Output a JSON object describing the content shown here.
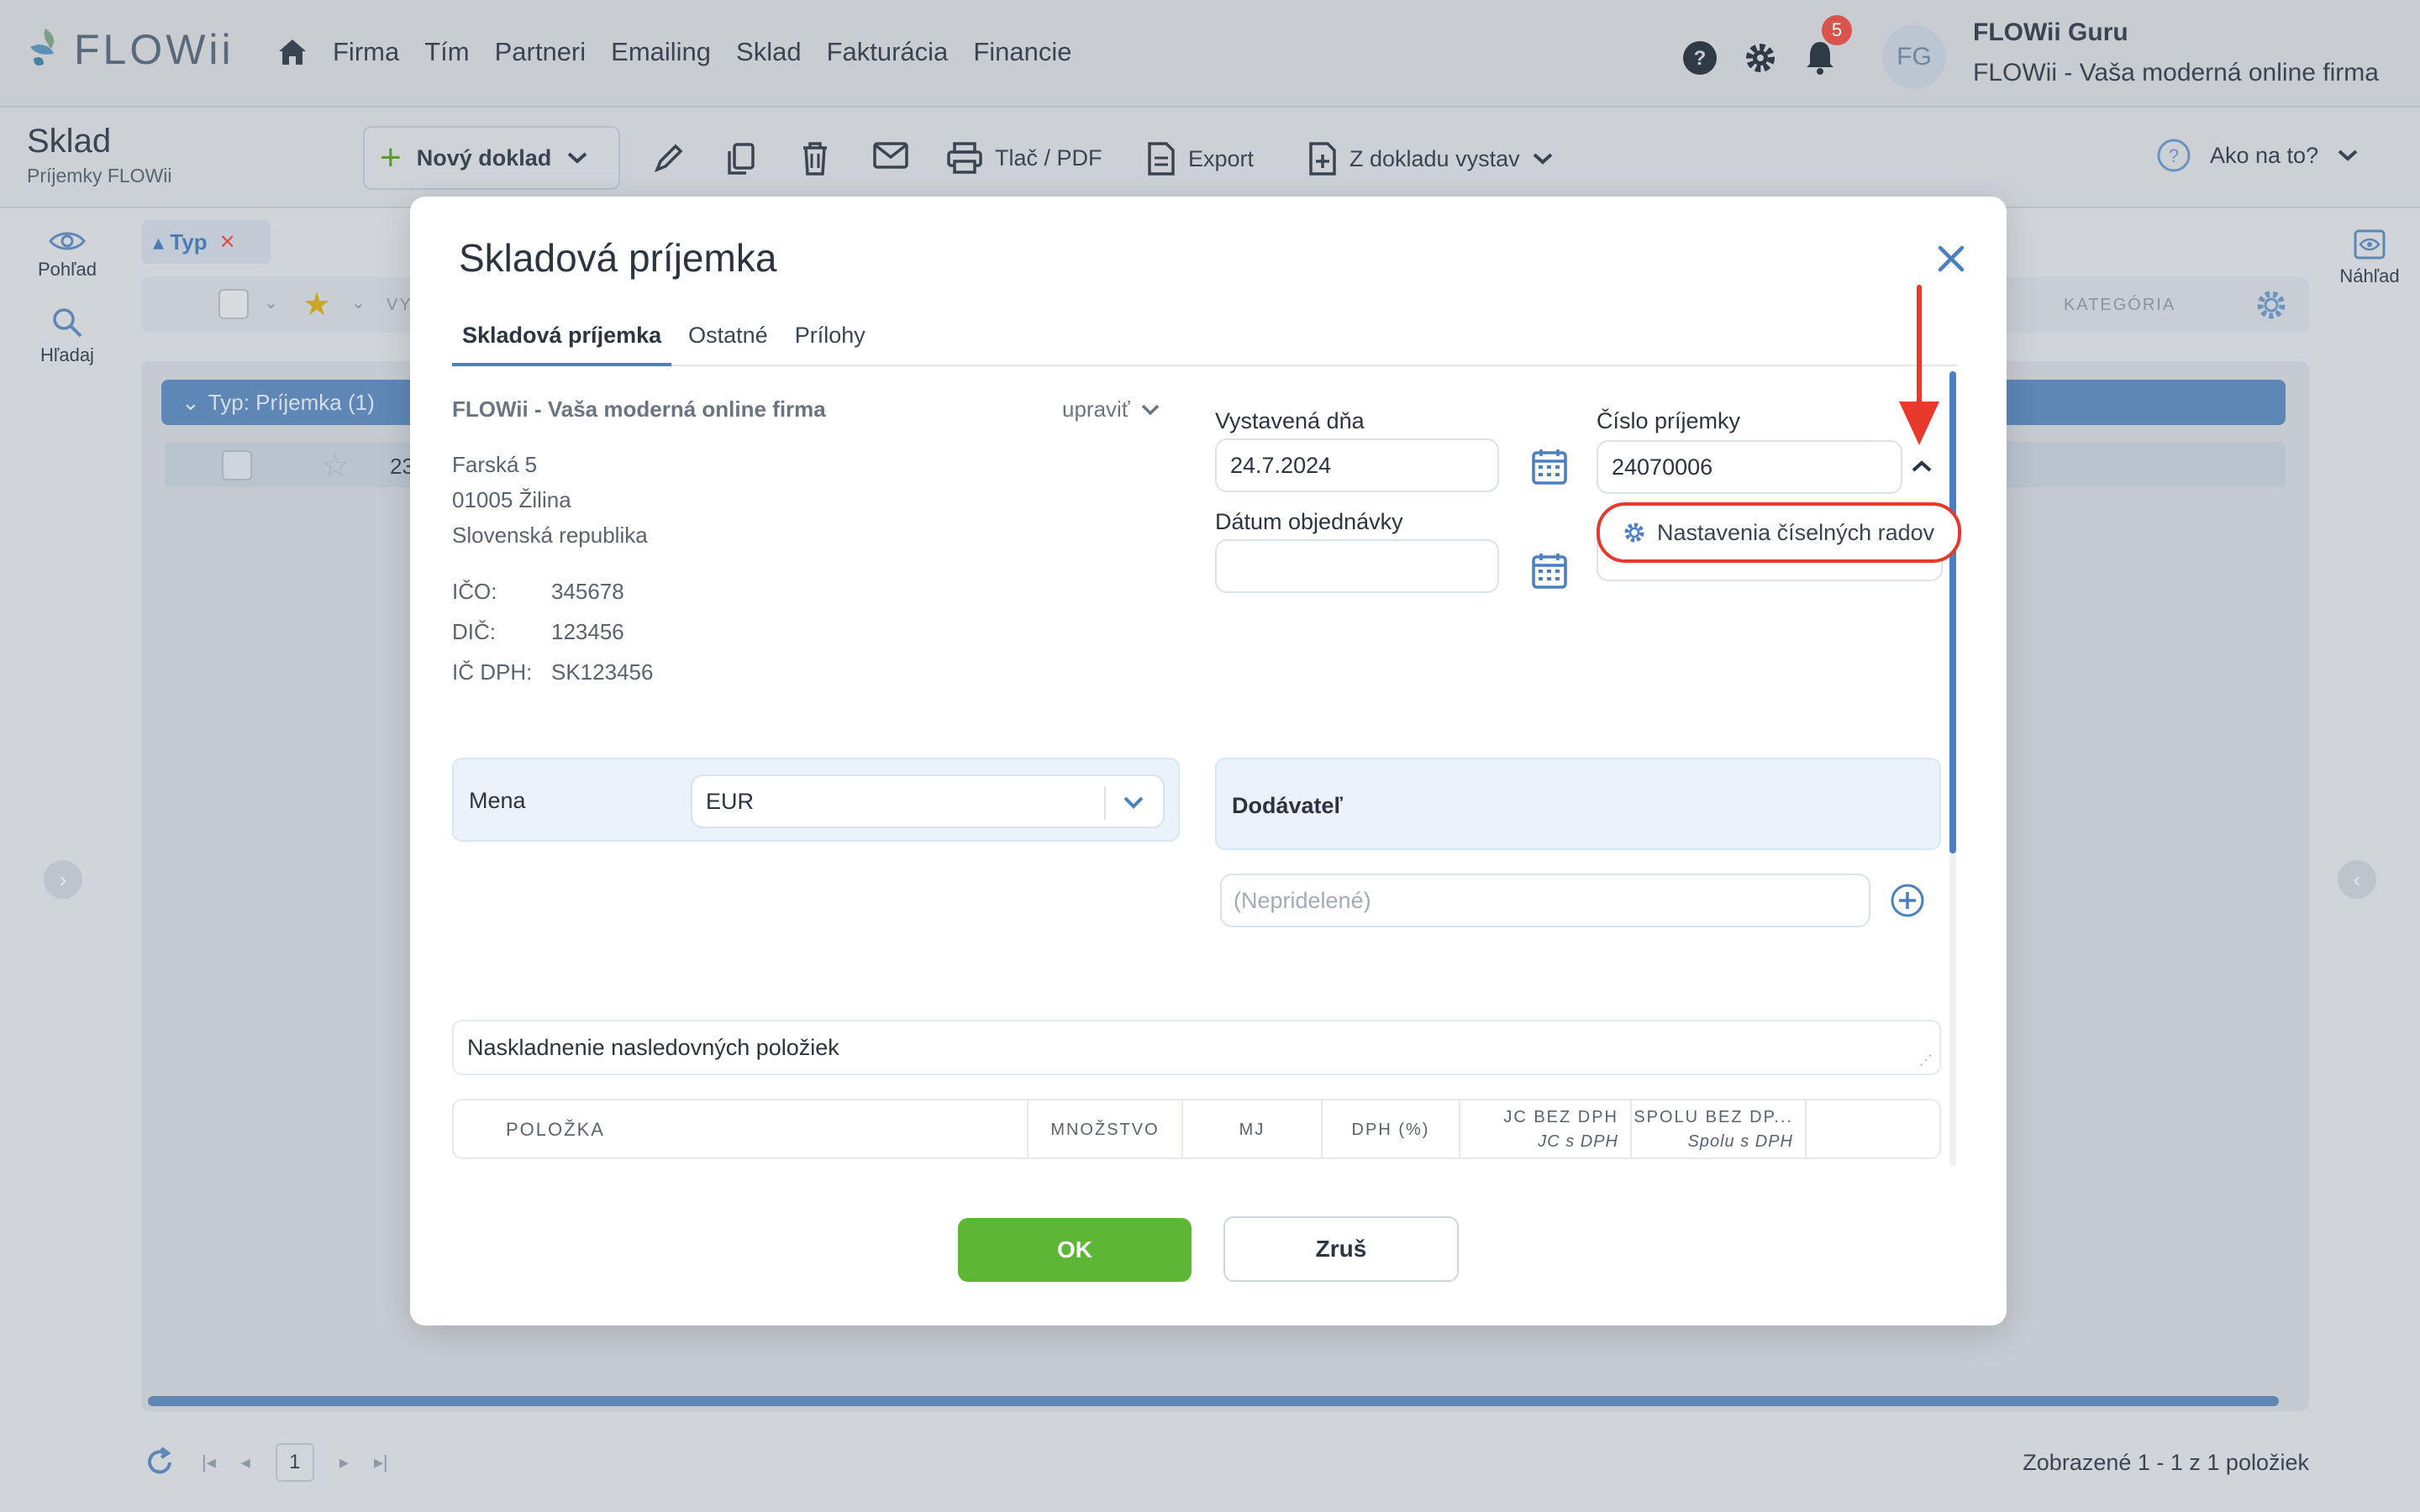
{
  "app": {
    "logo_text": "FLOWii",
    "nav": [
      "Firma",
      "Tím",
      "Partneri",
      "Emailing",
      "Sklad",
      "Fakturácia",
      "Financie"
    ],
    "notifications_count": "5",
    "avatar_initials": "FG",
    "user_name": "FLOWii Guru",
    "user_company": "FLOWii - Vaša moderná online firma"
  },
  "subbar": {
    "title": "Sklad",
    "subtitle": "Príjemky FLOWii",
    "new_doc": "Nový doklad",
    "print": "Tlač / PDF",
    "export": "Export",
    "from_doc": "Z dokladu vystav",
    "help": "Ako na to?"
  },
  "side": {
    "view": "Pohľad",
    "search": "Hľadaj",
    "preview": "Náhľad"
  },
  "grid": {
    "filter_chip": "Typ",
    "col_partial": "VY",
    "col_category": "KATEGÓRIA",
    "group_label": "Typ: Príjemka (1)",
    "row_partial": "23",
    "page": "1",
    "footer": "Zobrazené 1 - 1 z 1 položiek"
  },
  "modal": {
    "title": "Skladová príjemka",
    "tabs": [
      "Skladová príjemka",
      "Ostatné",
      "Prílohy"
    ],
    "company_name": "FLOWii - Vaša moderná online firma",
    "edit": "upraviť",
    "address": [
      "Farská 5",
      "01005 Žilina",
      "Slovenská republika"
    ],
    "ids": [
      {
        "k": "IČO:",
        "v": "345678"
      },
      {
        "k": "DIČ:",
        "v": "123456"
      },
      {
        "k": "IČ DPH:",
        "v": "SK123456"
      }
    ],
    "issued_label": "Vystavená dňa",
    "issued_value": "24.7.2024",
    "order_date_label": "Dátum objednávky",
    "order_date_value": "",
    "number_label": "Číslo príjemky",
    "number_value": "24070006",
    "number_dropdown_item": "Nastavenia číselných radov",
    "currency_label": "Mena",
    "currency_value": "EUR",
    "supplier_label": "Dodávateľ",
    "supplier_placeholder": "(Nepridelené)",
    "note": "Naskladnenie nasledovných položiek",
    "table_headers": {
      "item": "POLOŽKA",
      "qty": "MNOŽSTVO",
      "unit": "MJ",
      "vat": "DPH (%)",
      "unit_price": "JC BEZ DPH",
      "unit_price_vat": "JC s DPH",
      "total": "SPOLU BEZ DP...",
      "total_vat": "Spolu s DPH"
    },
    "ok": "OK",
    "cancel": "Zruš"
  },
  "colors": {
    "accent": "#4a7fc1",
    "ok_green": "#5db735",
    "highlight_red": "#e8392c"
  }
}
